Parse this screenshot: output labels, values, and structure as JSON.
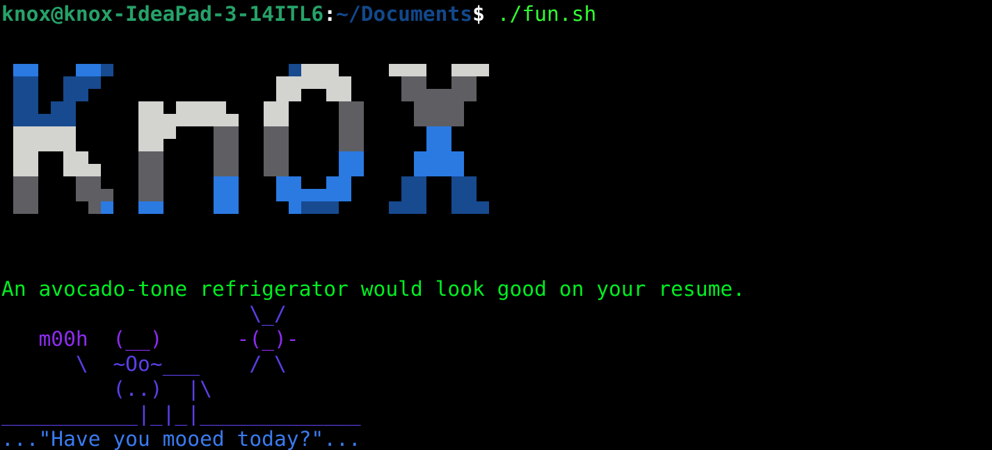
{
  "prompt": {
    "user_host": "knox@knox-IdeaPad-3-14ITL6",
    "colon": ":",
    "path": "~/Documents",
    "dollar": "$",
    "command": " ./fun.sh"
  },
  "banner": {
    "text": "knox",
    "palette": {
      "light_blue": "#2a7ae2",
      "dark_blue": "#174a8f",
      "white": "#d3d3d0",
      "gray": "#5f5e63"
    }
  },
  "fortune": {
    "text": "An avocado-tone refrigerator would look good on your resume."
  },
  "cowsay": {
    "lines": [
      "                    \\_/",
      "   m00h  (__)      -(_)-",
      "      \\  ~Oo~___    / \\",
      "         (..)  |\\",
      "___________|_|_|_____________",
      "...\"Have you mooed today?\"..."
    ],
    "colors": {
      "purple": "#8e2cf0",
      "blue": "#5b3fe8",
      "sky": "#3a7bf0"
    }
  }
}
